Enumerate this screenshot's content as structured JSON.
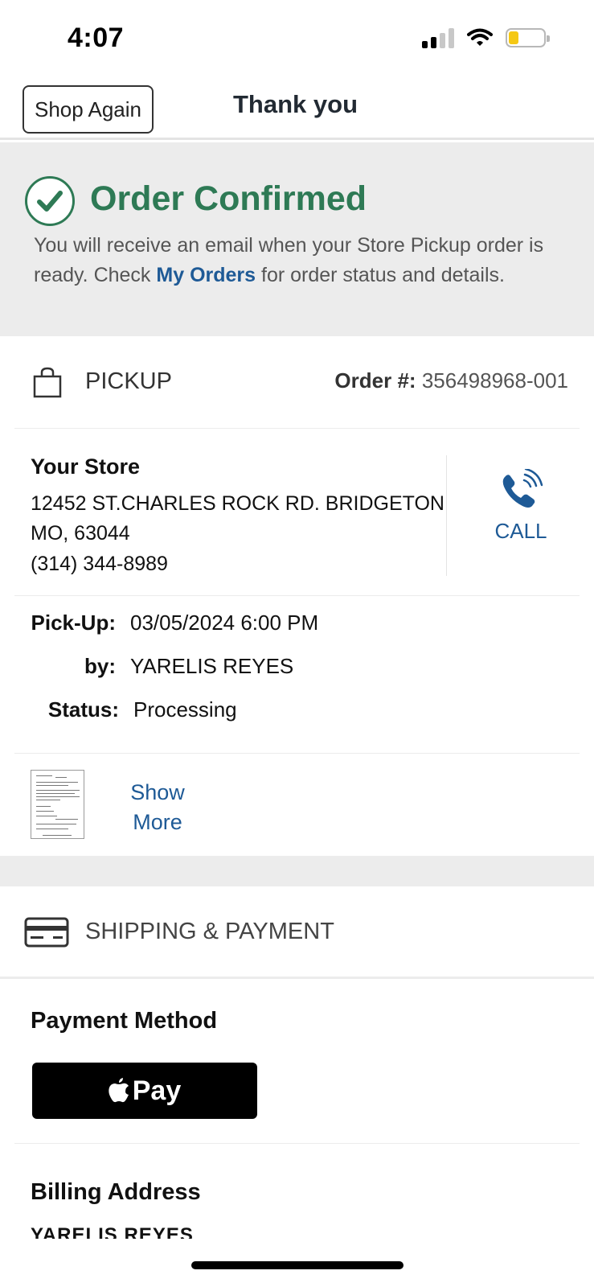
{
  "status_bar": {
    "time": "4:07"
  },
  "header": {
    "shop_again_label": "Shop Again",
    "title": "Thank you"
  },
  "confirmation": {
    "title": "Order Confirmed",
    "message_before": "You will receive an email when your Store Pickup order is ready. Check ",
    "link_text": "My Orders",
    "message_after": " for order status and details.",
    "accent_color": "#2e7a55"
  },
  "pickup": {
    "section_label": "PICKUP",
    "order_label": "Order #:",
    "order_number": "356498968-001",
    "store": {
      "name": "Your Store",
      "address": "12452 ST.CHARLES ROCK RD. BRIDGETON MO, 63044",
      "phone": "(314) 344-8989",
      "call_label": "CALL"
    },
    "details": {
      "pickup_key": "Pick-Up:",
      "pickup_value": "03/05/2024 6:00 PM",
      "by_key": "by:",
      "by_value": "YARELIS REYES",
      "status_key": "Status:",
      "status_value": "Processing"
    },
    "show_more_label": "Show More"
  },
  "shipping_payment": {
    "section_label": "SHIPPING & PAYMENT",
    "payment_method_title": "Payment Method",
    "payment_method": "Pay",
    "billing_title": "Billing Address",
    "billing_name": "YARELIS REYES"
  },
  "colors": {
    "link": "#1e5a96",
    "band": "#ececec"
  }
}
